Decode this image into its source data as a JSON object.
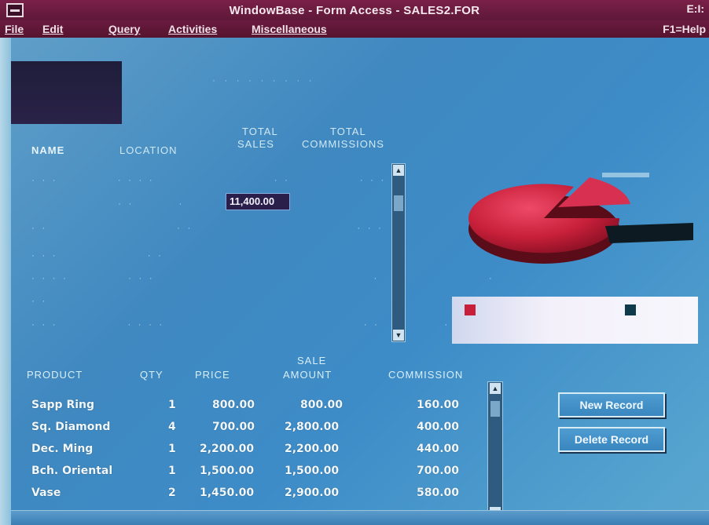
{
  "window": {
    "title": "WindowBase - Form Access - SALES2.FOR",
    "controls": "E:I:"
  },
  "menubar": {
    "items": [
      "File",
      "Edit",
      "Query",
      "Activities",
      "Miscellaneous"
    ],
    "help": "F1=Help"
  },
  "upper_table": {
    "headers": {
      "name": "NAME",
      "location": "LOCATION",
      "total_sales_1": "TOTAL",
      "total_sales_2": "SALES",
      "total_comm_1": "TOTAL",
      "total_comm_2": "COMMISSIONS"
    },
    "highlighted_value": "11,400.00"
  },
  "lower_table": {
    "headers": {
      "product": "PRODUCT",
      "qty": "QTY",
      "price": "PRICE",
      "amount_1": "SALE",
      "amount_2": "AMOUNT",
      "commission": "COMMISSION"
    },
    "rows": [
      {
        "product": "Sapp Ring",
        "qty": "1",
        "price": "800.00",
        "amount": "800.00",
        "commission": "160.00"
      },
      {
        "product": "Sq. Diamond",
        "qty": "4",
        "price": "700.00",
        "amount": "2,800.00",
        "commission": "400.00"
      },
      {
        "product": "Dec. Ming",
        "qty": "1",
        "price": "2,200.00",
        "amount": "2,200.00",
        "commission": "440.00"
      },
      {
        "product": "Bch. Oriental",
        "qty": "1",
        "price": "1,500.00",
        "amount": "1,500.00",
        "commission": "700.00"
      },
      {
        "product": "Vase",
        "qty": "2",
        "price": "1,450.00",
        "amount": "2,900.00",
        "commission": "580.00"
      }
    ]
  },
  "buttons": {
    "new_record": "New Record",
    "delete_record": "Delete Record"
  },
  "colors": {
    "titlebar": "#6a1a3e",
    "client_bg": "#3f88c0",
    "pie_main": "#c8203a",
    "pie_shadow": "#6a0e1e"
  },
  "icons": [
    "system-menu-icon",
    "scroll-up-icon",
    "scroll-down-icon",
    "pie-chart-icon"
  ]
}
